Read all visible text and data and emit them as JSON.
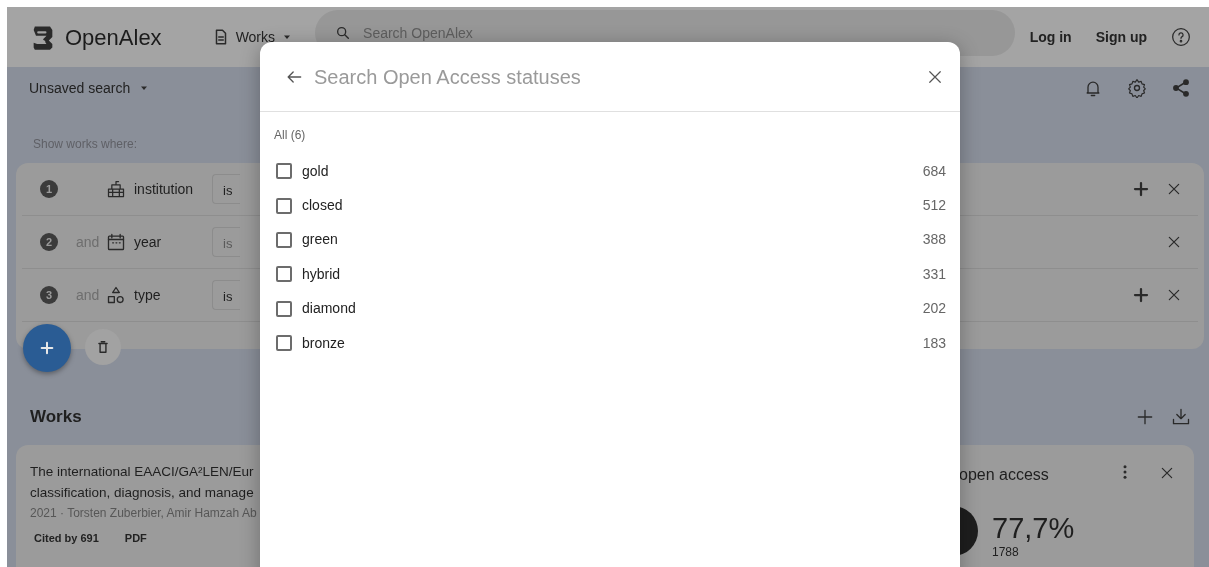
{
  "navbar": {
    "logo": "OpenAlex",
    "entity_menu": "Works",
    "search": {
      "placeholder": "Search OpenAlex"
    },
    "login": "Log in",
    "signup": "Sign up"
  },
  "toolbar": {
    "title": "Unsaved search"
  },
  "filters": {
    "heading": "Show works where:",
    "rows": [
      {
        "number": "1",
        "kind": "institution",
        "label": "institution",
        "operator": "is",
        "operator_disabled": false,
        "addable": true
      },
      {
        "number": "2",
        "conjunction": "and",
        "kind": "date",
        "label": "year",
        "operator": "is",
        "operator_disabled": true,
        "addable": false
      },
      {
        "number": "3",
        "conjunction": "and",
        "kind": "type",
        "label": "type",
        "operator": "is",
        "operator_disabled": false,
        "addable": true
      }
    ]
  },
  "works": {
    "heading": "Works",
    "results": [
      {
        "title_lines": [
          "The international EAACI/GA²LEN/Eur",
          "classification, diagnosis, and manage"
        ],
        "meta": "2021 · Torsten Zuberbier, Amir Hamzah Ab",
        "badges": [
          "Cited by 691",
          "PDF"
        ]
      }
    ],
    "stat_panel": {
      "title": "open access",
      "percent": "77,7%",
      "count": "1788"
    }
  },
  "modal": {
    "placeholder": "Search Open Access statuses",
    "all_label": "All (6)",
    "options": [
      {
        "label": "gold",
        "count": "684",
        "checked": false
      },
      {
        "label": "closed",
        "count": "512",
        "checked": false
      },
      {
        "label": "green",
        "count": "388",
        "checked": false
      },
      {
        "label": "hybrid",
        "count": "331",
        "checked": false
      },
      {
        "label": "diamond",
        "count": "202",
        "checked": false
      },
      {
        "label": "bronze",
        "count": "183",
        "checked": false
      }
    ]
  }
}
